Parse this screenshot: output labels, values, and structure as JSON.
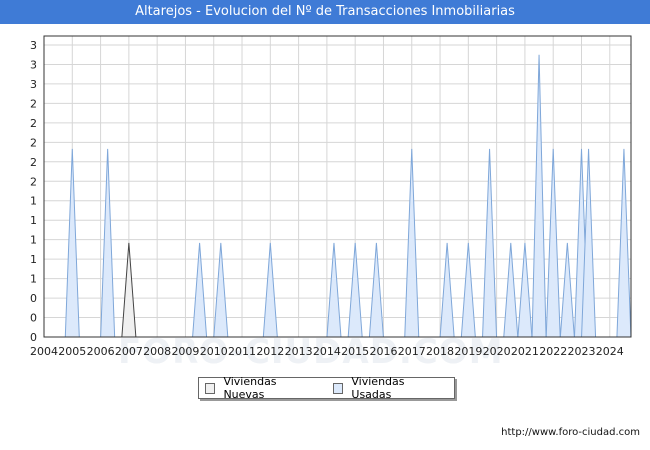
{
  "header": {
    "title": "Altarejos - Evolucion del Nº de Transacciones Inmobiliarias"
  },
  "watermark": "FORO-CIUDAD.COM",
  "footer": {
    "url": "http://www.foro-ciudad.com"
  },
  "colors": {
    "title_bg": "#3f7bd6",
    "nuevas_fill": "#f0f0f0",
    "nuevas_stroke": "#444444",
    "usadas_fill": "#dce9fb",
    "usadas_stroke": "#7fa7d9"
  },
  "chart_data": {
    "type": "area",
    "title": "Altarejos - Evolucion del Nº de Transacciones Inmobiliarias",
    "xlabel": "",
    "ylabel": "",
    "x_tick_labels": [
      "2004",
      "2005",
      "2006",
      "2007",
      "2008",
      "2009",
      "2010",
      "2011",
      "2012",
      "2013",
      "2014",
      "2015",
      "2016",
      "2017",
      "2018",
      "2019",
      "2020",
      "2021",
      "2022",
      "2023",
      "2024"
    ],
    "y_tick_labels": [
      "0",
      "0",
      "0",
      "1",
      "1",
      "1",
      "1",
      "1",
      "2",
      "2",
      "2",
      "2",
      "2",
      "3",
      "3",
      "3"
    ],
    "ylim": [
      0,
      3.2
    ],
    "xlim": [
      2004,
      2024.75
    ],
    "grid": true,
    "legend_position": "bottom-center",
    "series": [
      {
        "name": "Viviendas Nuevas",
        "peaks": [
          {
            "x": 2007.0,
            "y": 1
          }
        ]
      },
      {
        "name": "Viviendas Usadas",
        "peaks": [
          {
            "x": 2005.0,
            "y": 2
          },
          {
            "x": 2006.25,
            "y": 2
          },
          {
            "x": 2009.5,
            "y": 1
          },
          {
            "x": 2010.25,
            "y": 1
          },
          {
            "x": 2012.0,
            "y": 1
          },
          {
            "x": 2014.25,
            "y": 1
          },
          {
            "x": 2015.0,
            "y": 1
          },
          {
            "x": 2015.75,
            "y": 1
          },
          {
            "x": 2017.0,
            "y": 2
          },
          {
            "x": 2018.25,
            "y": 1
          },
          {
            "x": 2019.0,
            "y": 1
          },
          {
            "x": 2019.75,
            "y": 2
          },
          {
            "x": 2020.5,
            "y": 1
          },
          {
            "x": 2021.0,
            "y": 1
          },
          {
            "x": 2021.5,
            "y": 3
          },
          {
            "x": 2022.0,
            "y": 2
          },
          {
            "x": 2022.5,
            "y": 1
          },
          {
            "x": 2023.0,
            "y": 2
          },
          {
            "x": 2023.25,
            "y": 2
          },
          {
            "x": 2024.5,
            "y": 2
          }
        ]
      }
    ]
  }
}
